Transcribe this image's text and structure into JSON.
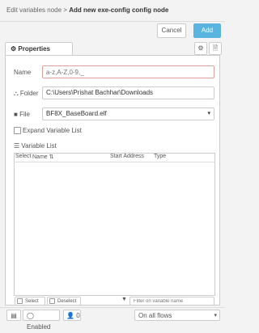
{
  "header": {
    "breadcrumb_prefix": "Edit variables node",
    "breadcrumb_sep": ">",
    "breadcrumb_current": "Add new exe-config config node"
  },
  "actions": {
    "cancel_label": "Cancel",
    "add_label": "Add"
  },
  "tabs": {
    "properties_label": "Properties"
  },
  "form": {
    "name_label": "Name",
    "name_placeholder": "a-z,A-Z,0-9,_",
    "folder_label": "Folder",
    "folder_value": "C:\\Users\\Prishat Bachhar\\Downloads",
    "file_label": "File",
    "file_value": "BF8X_BaseBoard.elf",
    "expand_label": "Expand Variable List",
    "variable_list_label": "Variable List"
  },
  "table": {
    "col_select": "Select",
    "col_name": "Name",
    "col_start": "Start Address",
    "col_type": "Type"
  },
  "tools": {
    "select_all": "Select All",
    "deselect_all": "Deselect All",
    "filter_placeholder": "Filter on variable name"
  },
  "footer": {
    "enabled_label": "Enabled",
    "users_count": "0",
    "flows_value": "On all flows"
  },
  "colors": {
    "accent": "#5ab4e0",
    "error_border": "#e2a09a"
  }
}
